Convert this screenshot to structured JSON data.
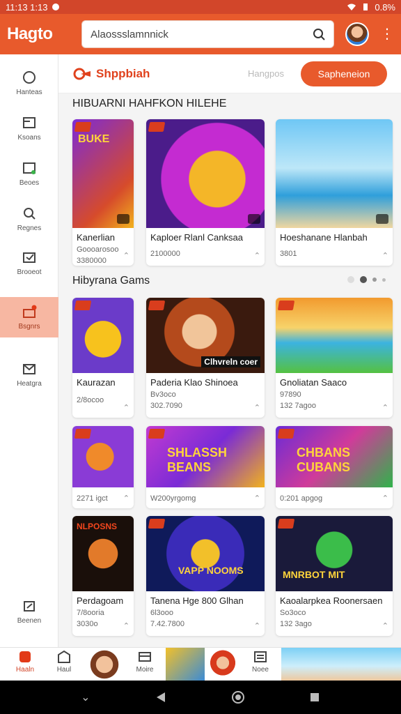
{
  "status": {
    "time": "11:13 1:13",
    "battery": "0.8%"
  },
  "appbar": {
    "logo": "Hagto",
    "search_text": "Alaossslamnnick",
    "menu_icon": "more-vert-icon"
  },
  "sidebar": {
    "items": [
      {
        "label": "Hanteas",
        "icon": "circle-icon"
      },
      {
        "label": "Ksoans",
        "icon": "box-icon"
      },
      {
        "label": "Beoes",
        "icon": "tablet-icon"
      },
      {
        "label": "Regnes",
        "icon": "search-person-icon"
      },
      {
        "label": "Brooeot",
        "icon": "folder-icon"
      },
      {
        "label": "Bsgnrs",
        "icon": "gift-icon"
      },
      {
        "label": "Heatgra",
        "icon": "mail-icon"
      },
      {
        "label": "Beenen",
        "icon": "share-icon"
      }
    ]
  },
  "topnav": {
    "brand": "Shppbiah",
    "mid": "Hangpos",
    "pill": "Sapheneion"
  },
  "sections": [
    {
      "title": "HIBUARNI HAHFKON HILEHE"
    },
    {
      "title": "Hibyrana Gams"
    }
  ],
  "cards_row1": [
    {
      "title": "Kanerlian",
      "meta": "Goooarosoo",
      "meta2": "3380000",
      "corner": "⌃"
    },
    {
      "title": "Kaploer Rlanl Canksaa",
      "meta": "2100000",
      "meta2": "",
      "corner": "⌃"
    },
    {
      "title": "Hoeshanane Hlanbah",
      "meta": "3801",
      "meta2": "",
      "corner": "⌃"
    }
  ],
  "cards_row2": [
    {
      "title": "Kaurazan",
      "meta": "2/8ocoo",
      "corner": "⌃"
    },
    {
      "title": "Paderia Klao Shinoea",
      "meta": "Bv3oco",
      "meta2": "302.7090",
      "corner": "⌃"
    },
    {
      "title": "Gnoliatan Saaco",
      "meta": "97890",
      "meta2": "132 7agoo",
      "corner": "⌃"
    }
  ],
  "cards_row3": [
    {
      "meta": "2271 igct",
      "corner": "⌃"
    },
    {
      "meta": "W200yrgomg",
      "corner": "⌃"
    },
    {
      "meta": "0:201 apgog",
      "corner": "⌃"
    }
  ],
  "cards_row4": [
    {
      "title": "Perdagoam",
      "meta": "7/8ooria",
      "meta2": "3030o",
      "corner": "⌃"
    },
    {
      "title": "Tanena Hge 800 Glhan",
      "meta": "6l3ooo",
      "meta2": "7.42.7800",
      "corner": "⌃"
    },
    {
      "title": "Kaoalarpkea Roonersaen",
      "meta": "So3oco",
      "meta2": "132 3ago",
      "corner": "⌃"
    }
  ],
  "bottomnav": [
    {
      "label": "Haaln",
      "icon": "home-icon"
    },
    {
      "label": "Haul",
      "icon": "shield-icon"
    },
    {
      "label": "Moire",
      "icon": "controller-icon"
    },
    {
      "label": "Noee",
      "icon": "grid-icon"
    }
  ],
  "thumb_labels": [
    "Clhvreln coer",
    "SHLASSH BEANS",
    "CHBANS CUBANS",
    "MNRBOT MIT",
    "NLPOSNS",
    "VAPP NOOMS",
    "BUKE"
  ],
  "colors": {
    "accent": "#e85a2c",
    "status": "#d2462a",
    "active_side": "#f7b7a2"
  }
}
